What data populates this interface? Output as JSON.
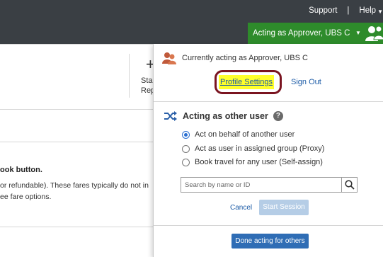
{
  "header": {
    "support_label": "Support",
    "separator": "|",
    "help_label": "Help",
    "acting_label": "Acting as Approver, UBS C",
    "colors": {
      "bar": "#3a3f44",
      "acting_bar": "#2e8b2b"
    }
  },
  "background_page": {
    "plus_glyph": "+",
    "fragment_sta": "Sta",
    "fragment_rep": "Rep",
    "fragment_book": "ook button.",
    "fragment_fares": "or refundable).  These fares typically do not in",
    "fragment_see": "ee fare options."
  },
  "panel": {
    "currently_acting": "Currently acting as Approver, UBS C",
    "profile_settings_label": "Profile Settings",
    "sign_out_label": "Sign Out",
    "section_title": "Acting as other user",
    "help_icon_glyph": "?",
    "options": [
      {
        "label": "Act on behalf of another user",
        "selected": true
      },
      {
        "label": "Act as user in assigned group (Proxy)",
        "selected": false
      },
      {
        "label": "Book travel for any user (Self-assign)",
        "selected": false
      }
    ],
    "search_placeholder": "Search by name or ID",
    "search_value": "",
    "cancel_label": "Cancel",
    "start_session_label": "Start Session",
    "start_session_enabled": false,
    "done_label": "Done acting for others",
    "colors": {
      "link": "#1a5aa6",
      "highlight": "#ffff2b",
      "annotation_ring": "#7a1420",
      "primary_button": "#2f6db5",
      "disabled_button": "#b5cde6"
    }
  },
  "icons": {
    "users": "users-group-icon",
    "dropdown": "chevron-down-icon",
    "approver": "user-approver-icon",
    "shuffle": "shuffle-icon",
    "help": "help-icon",
    "search": "search-icon"
  }
}
